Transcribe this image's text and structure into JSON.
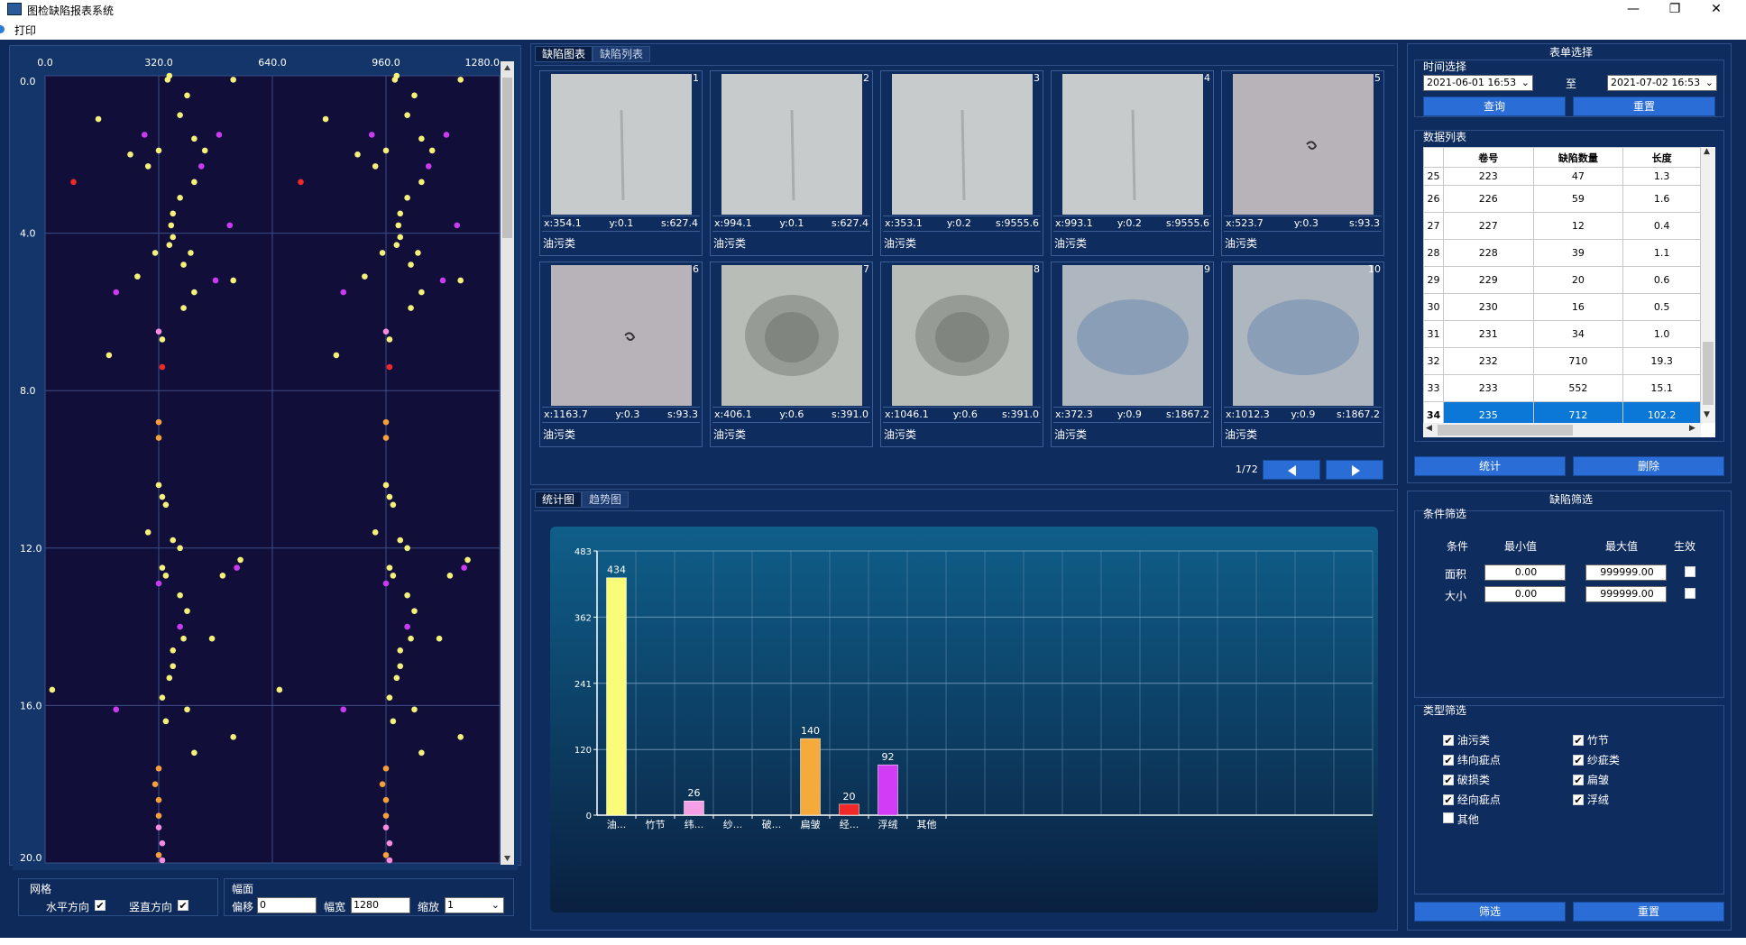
{
  "window": {
    "title": "图检缺陷报表系统",
    "minimize": "—",
    "restore": "❐",
    "close": "✕"
  },
  "menu": {
    "print": "打印"
  },
  "scatter": {
    "x_ticks": [
      "0.0",
      "320.0",
      "640.0",
      "960.0",
      "1280.0"
    ],
    "y_ticks": [
      "0.0",
      "4.0",
      "8.0",
      "12.0",
      "16.0",
      "20.0"
    ],
    "points_left": [
      {
        "x": 345,
        "y": 0.1,
        "c": "yellow"
      },
      {
        "x": 350,
        "y": 0.0,
        "c": "yellow"
      },
      {
        "x": 530,
        "y": 0.1,
        "c": "yellow"
      },
      {
        "x": 400,
        "y": 0.5,
        "c": "yellow"
      },
      {
        "x": 150,
        "y": 1.1,
        "c": "yellow"
      },
      {
        "x": 380,
        "y": 1.0,
        "c": "yellow"
      },
      {
        "x": 280,
        "y": 1.5,
        "c": "magenta"
      },
      {
        "x": 490,
        "y": 1.5,
        "c": "magenta"
      },
      {
        "x": 420,
        "y": 1.6,
        "c": "yellow"
      },
      {
        "x": 240,
        "y": 2.0,
        "c": "yellow"
      },
      {
        "x": 320,
        "y": 1.9,
        "c": "yellow"
      },
      {
        "x": 450,
        "y": 1.9,
        "c": "yellow"
      },
      {
        "x": 290,
        "y": 2.3,
        "c": "yellow"
      },
      {
        "x": 440,
        "y": 2.3,
        "c": "magenta"
      },
      {
        "x": 80,
        "y": 2.7,
        "c": "red"
      },
      {
        "x": 420,
        "y": 2.7,
        "c": "yellow"
      },
      {
        "x": 380,
        "y": 3.1,
        "c": "yellow"
      },
      {
        "x": 360,
        "y": 3.5,
        "c": "yellow"
      },
      {
        "x": 355,
        "y": 3.8,
        "c": "yellow"
      },
      {
        "x": 520,
        "y": 3.8,
        "c": "magenta"
      },
      {
        "x": 360,
        "y": 4.1,
        "c": "yellow"
      },
      {
        "x": 350,
        "y": 4.3,
        "c": "yellow"
      },
      {
        "x": 310,
        "y": 4.5,
        "c": "yellow"
      },
      {
        "x": 410,
        "y": 4.5,
        "c": "yellow"
      },
      {
        "x": 390,
        "y": 4.8,
        "c": "yellow"
      },
      {
        "x": 260,
        "y": 5.1,
        "c": "yellow"
      },
      {
        "x": 480,
        "y": 5.2,
        "c": "magenta"
      },
      {
        "x": 530,
        "y": 5.2,
        "c": "yellow"
      },
      {
        "x": 200,
        "y": 5.5,
        "c": "magenta"
      },
      {
        "x": 420,
        "y": 5.5,
        "c": "yellow"
      },
      {
        "x": 390,
        "y": 5.9,
        "c": "yellow"
      },
      {
        "x": 320,
        "y": 6.5,
        "c": "pink"
      },
      {
        "x": 330,
        "y": 6.7,
        "c": "yellow"
      },
      {
        "x": 180,
        "y": 7.1,
        "c": "yellow"
      },
      {
        "x": 330,
        "y": 7.4,
        "c": "red"
      },
      {
        "x": 320,
        "y": 8.8,
        "c": "orange"
      },
      {
        "x": 320,
        "y": 9.2,
        "c": "orange"
      },
      {
        "x": 320,
        "y": 10.4,
        "c": "yellow"
      },
      {
        "x": 330,
        "y": 10.7,
        "c": "yellow"
      },
      {
        "x": 340,
        "y": 10.9,
        "c": "yellow"
      },
      {
        "x": 290,
        "y": 11.6,
        "c": "yellow"
      },
      {
        "x": 360,
        "y": 11.8,
        "c": "yellow"
      },
      {
        "x": 380,
        "y": 12.0,
        "c": "yellow"
      },
      {
        "x": 330,
        "y": 12.5,
        "c": "yellow"
      },
      {
        "x": 340,
        "y": 12.7,
        "c": "yellow"
      },
      {
        "x": 550,
        "y": 12.3,
        "c": "yellow"
      },
      {
        "x": 540,
        "y": 12.5,
        "c": "magenta"
      },
      {
        "x": 500,
        "y": 12.7,
        "c": "yellow"
      },
      {
        "x": 320,
        "y": 12.9,
        "c": "magenta"
      },
      {
        "x": 380,
        "y": 13.2,
        "c": "yellow"
      },
      {
        "x": 400,
        "y": 13.6,
        "c": "yellow"
      },
      {
        "x": 380,
        "y": 14.0,
        "c": "magenta"
      },
      {
        "x": 390,
        "y": 14.3,
        "c": "yellow"
      },
      {
        "x": 470,
        "y": 14.3,
        "c": "yellow"
      },
      {
        "x": 360,
        "y": 14.6,
        "c": "yellow"
      },
      {
        "x": 360,
        "y": 15.0,
        "c": "yellow"
      },
      {
        "x": 350,
        "y": 15.3,
        "c": "yellow"
      },
      {
        "x": 20,
        "y": 15.6,
        "c": "yellow"
      },
      {
        "x": 330,
        "y": 15.8,
        "c": "yellow"
      },
      {
        "x": 200,
        "y": 16.1,
        "c": "magenta"
      },
      {
        "x": 400,
        "y": 16.1,
        "c": "yellow"
      },
      {
        "x": 340,
        "y": 16.4,
        "c": "yellow"
      },
      {
        "x": 530,
        "y": 16.8,
        "c": "yellow"
      },
      {
        "x": 420,
        "y": 17.2,
        "c": "yellow"
      },
      {
        "x": 320,
        "y": 17.6,
        "c": "orange"
      },
      {
        "x": 310,
        "y": 18.0,
        "c": "orange"
      },
      {
        "x": 320,
        "y": 18.4,
        "c": "orange"
      },
      {
        "x": 320,
        "y": 18.8,
        "c": "orange"
      },
      {
        "x": 320,
        "y": 19.1,
        "c": "pink"
      },
      {
        "x": 330,
        "y": 19.5,
        "c": "pink"
      },
      {
        "x": 320,
        "y": 19.8,
        "c": "orange"
      },
      {
        "x": 330,
        "y": 20.0,
        "c": "pink"
      }
    ],
    "colors": {
      "yellow": "#f5f07a",
      "magenta": "#c83cf0",
      "red": "#f02828",
      "pink": "#f58ce0",
      "orange": "#f5a03c"
    }
  },
  "grid": {
    "label": "网格",
    "horizontal": "水平方向",
    "vertical": "竖直方向"
  },
  "scale": {
    "label": "幅面",
    "offset_label": "偏移",
    "offset_value": "0",
    "width_label": "幅宽",
    "width_value": "1280",
    "zoom_label": "缩放",
    "zoom_value": "1"
  },
  "top_tabs": {
    "chart": "缺陷图表",
    "list": "缺陷列表"
  },
  "tiles": [
    {
      "idx": "1",
      "x": "x:354.1",
      "y": "y:0.1",
      "s": "s:627.4",
      "cls": "油污类",
      "tone": "light"
    },
    {
      "idx": "2",
      "x": "x:994.1",
      "y": "y:0.1",
      "s": "s:627.4",
      "cls": "油污类",
      "tone": "light"
    },
    {
      "idx": "3",
      "x": "x:353.1",
      "y": "y:0.2",
      "s": "s:9555.6",
      "cls": "油污类",
      "tone": "light"
    },
    {
      "idx": "4",
      "x": "x:993.1",
      "y": "y:0.2",
      "s": "s:9555.6",
      "cls": "油污类",
      "tone": "light"
    },
    {
      "idx": "5",
      "x": "x:523.7",
      "y": "y:0.3",
      "s": "s:93.3",
      "cls": "油污类",
      "tone": "dark"
    },
    {
      "idx": "6",
      "x": "x:1163.7",
      "y": "y:0.3",
      "s": "s:93.3",
      "cls": "油污类",
      "tone": "dark"
    },
    {
      "idx": "7",
      "x": "x:406.1",
      "y": "y:0.6",
      "s": "s:391.0",
      "cls": "油污类",
      "tone": "blot"
    },
    {
      "idx": "8",
      "x": "x:1046.1",
      "y": "y:0.6",
      "s": "s:391.0",
      "cls": "油污类",
      "tone": "blot"
    },
    {
      "idx": "9",
      "x": "x:372.3",
      "y": "y:0.9",
      "s": "s:1867.2",
      "cls": "油污类",
      "tone": "blue"
    },
    {
      "idx": "10",
      "x": "x:1012.3",
      "y": "y:0.9",
      "s": "s:1867.2",
      "cls": "油污类",
      "tone": "blue"
    }
  ],
  "pager": {
    "text": "1/72"
  },
  "chart_tabs": {
    "stats": "统计图",
    "trend": "趋势图"
  },
  "chart_data": {
    "type": "bar",
    "categories": [
      "油...",
      "竹节",
      "纬...",
      "纱...",
      "破...",
      "扁皱",
      "经...",
      "浮绒",
      "其他"
    ],
    "values": [
      434,
      0,
      26,
      0,
      0,
      140,
      20,
      92,
      0
    ],
    "colors": [
      "#fbfb7a",
      "#fbfb7a",
      "#f5a0e6",
      "#f5a0e6",
      "#f5a0e6",
      "#f5aa3c",
      "#f02828",
      "#d23cf5",
      "#d23cf5"
    ],
    "y_ticks": [
      "0",
      "120",
      "241",
      "362",
      "483"
    ],
    "ylim": [
      0,
      483
    ],
    "grid": true
  },
  "form": {
    "title": "表单选择",
    "time_label": "时间选择",
    "start": "2021-06-01 16:53",
    "to": "至",
    "end": "2021-07-02 16:53",
    "query": "查询",
    "reset": "重置",
    "list_label": "数据列表",
    "columns": [
      "卷号",
      "缺陷数量",
      "长度"
    ],
    "rows": [
      {
        "n": "25",
        "roll": "223",
        "count": "47",
        "len": "1.3"
      },
      {
        "n": "26",
        "roll": "226",
        "count": "59",
        "len": "1.6"
      },
      {
        "n": "27",
        "roll": "227",
        "count": "12",
        "len": "0.4"
      },
      {
        "n": "28",
        "roll": "228",
        "count": "39",
        "len": "1.1"
      },
      {
        "n": "29",
        "roll": "229",
        "count": "20",
        "len": "0.6"
      },
      {
        "n": "30",
        "roll": "230",
        "count": "16",
        "len": "0.5"
      },
      {
        "n": "31",
        "roll": "231",
        "count": "34",
        "len": "1.0"
      },
      {
        "n": "32",
        "roll": "232",
        "count": "710",
        "len": "19.3"
      },
      {
        "n": "33",
        "roll": "233",
        "count": "552",
        "len": "15.1"
      },
      {
        "n": "34",
        "roll": "235",
        "count": "712",
        "len": "102.2"
      }
    ],
    "stats": "统计",
    "delete": "删除"
  },
  "filter": {
    "title": "缺陷筛选",
    "cond_label": "条件筛选",
    "h_cond": "条件",
    "h_min": "最小值",
    "h_max": "最大值",
    "h_active": "生效",
    "area": "面积",
    "area_min": "0.00",
    "area_max": "999999.00",
    "size": "大小",
    "size_min": "0.00",
    "size_max": "999999.00",
    "type_label": "类型筛选",
    "types": [
      {
        "label": "油污类",
        "checked": "✔"
      },
      {
        "label": "竹节",
        "checked": "✔"
      },
      {
        "label": "纬向疵点",
        "checked": "✔"
      },
      {
        "label": "纱疵类",
        "checked": "✔"
      },
      {
        "label": "破损类",
        "checked": "✔"
      },
      {
        "label": "扁皱",
        "checked": "✔"
      },
      {
        "label": "经向疵点",
        "checked": "✔"
      },
      {
        "label": "浮绒",
        "checked": "✔"
      },
      {
        "label": "其他",
        "checked": ""
      }
    ],
    "apply": "筛选",
    "reset": "重置"
  }
}
